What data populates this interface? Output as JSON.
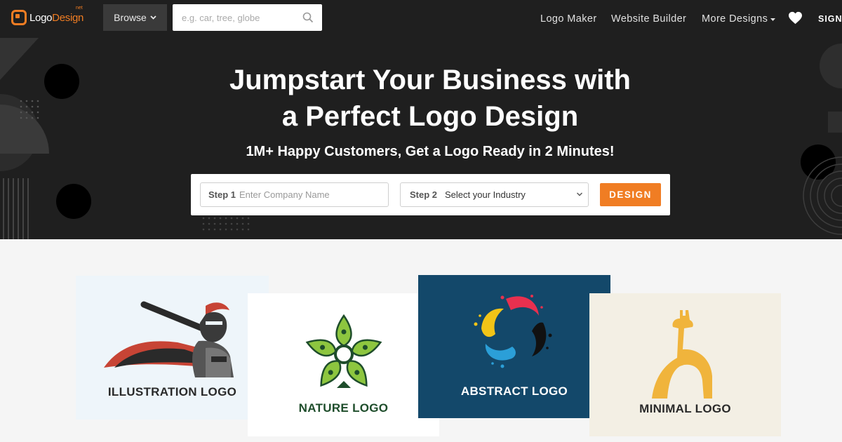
{
  "nav": {
    "logo_part1": "Logo",
    "logo_part2": "Design",
    "logo_suffix": "net",
    "browse_label": "Browse",
    "search_placeholder": "e.g. car, tree, globe",
    "links": [
      "Logo Maker",
      "Website Builder",
      "More Designs"
    ],
    "sign_label": "SIGN"
  },
  "hero": {
    "headline_line1": "Jumpstart Your Business with",
    "headline_line2": "a Perfect Logo Design",
    "subheadline": "1M+ Happy Customers, Get a Logo Ready in 2 Minutes!"
  },
  "form": {
    "step1_label": "Step 1",
    "step1_placeholder": "Enter Company Name",
    "step2_label": "Step 2",
    "step2_value": "Select your Industry",
    "button_label": "DESIGN"
  },
  "cards": [
    {
      "label": "ILLUSTRATION LOGO",
      "icon": "knight-baseball-icon"
    },
    {
      "label": "NATURE LOGO",
      "icon": "leaf-star-icon"
    },
    {
      "label": "ABSTRACT LOGO",
      "icon": "paint-splash-icon"
    },
    {
      "label": "MINIMAL LOGO",
      "icon": "giraffe-icon"
    }
  ],
  "colors": {
    "accent": "#f07d23",
    "hero_bg": "#1f1f1f",
    "nature_green": "#8dc63f",
    "abstract_bg": "#13486a",
    "minimal_gold": "#f0b43c"
  }
}
